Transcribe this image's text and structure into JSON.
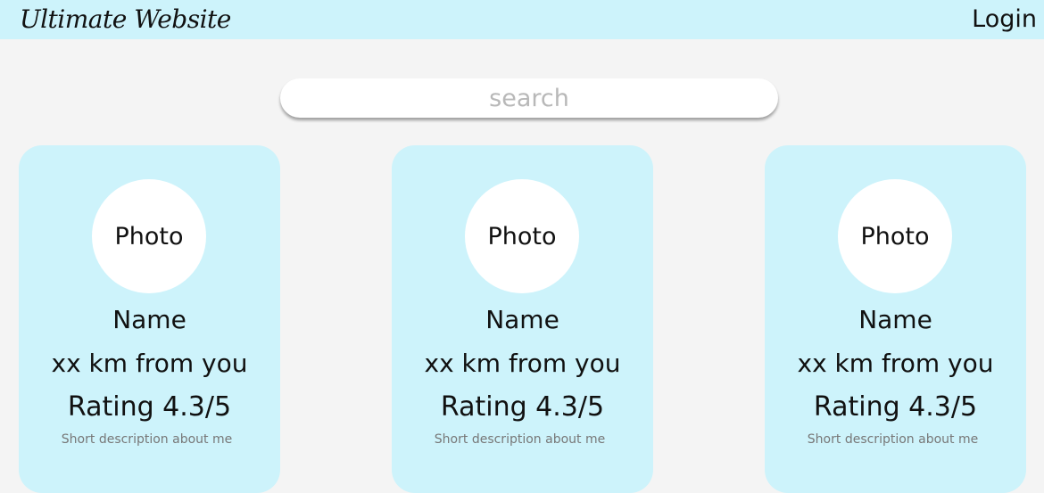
{
  "header": {
    "title": "Ultimate Website",
    "login_label": "Login"
  },
  "search": {
    "placeholder": "search"
  },
  "cards": [
    {
      "photo_label": "Photo",
      "name": "Name",
      "distance": "xx km from you",
      "rating": "Rating 4.3/5",
      "description": "Short description about me"
    },
    {
      "photo_label": "Photo",
      "name": "Name",
      "distance": "xx km from you",
      "rating": "Rating 4.3/5",
      "description": "Short description about me"
    },
    {
      "photo_label": "Photo",
      "name": "Name",
      "distance": "xx km from you",
      "rating": "Rating 4.3/5",
      "description": "Short description about me"
    }
  ],
  "colors": {
    "header_bg": "#cdf3fb",
    "card_bg": "#cdf3fb",
    "page_bg": "#f4f4f4"
  }
}
